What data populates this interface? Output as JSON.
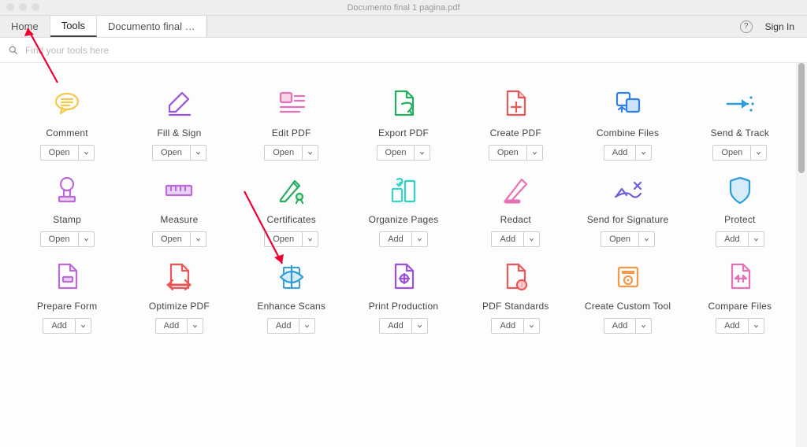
{
  "window": {
    "title": "Documento final 1 pagina.pdf"
  },
  "tabs": {
    "home": "Home",
    "tools": "Tools",
    "doc": "Documento final 1..."
  },
  "header": {
    "help": "?",
    "signin": "Sign In"
  },
  "search": {
    "placeholder": "Find your tools here"
  },
  "buttons": {
    "open": "Open",
    "add": "Add"
  },
  "tools": [
    {
      "label": "Comment",
      "action": "open"
    },
    {
      "label": "Fill & Sign",
      "action": "open"
    },
    {
      "label": "Edit PDF",
      "action": "open"
    },
    {
      "label": "Export PDF",
      "action": "open"
    },
    {
      "label": "Create PDF",
      "action": "open"
    },
    {
      "label": "Combine Files",
      "action": "add"
    },
    {
      "label": "Send & Track",
      "action": "open"
    },
    {
      "label": "Stamp",
      "action": "open"
    },
    {
      "label": "Measure",
      "action": "open"
    },
    {
      "label": "Certificates",
      "action": "open"
    },
    {
      "label": "Organize Pages",
      "action": "add"
    },
    {
      "label": "Redact",
      "action": "add"
    },
    {
      "label": "Send for Signature",
      "action": "open"
    },
    {
      "label": "Protect",
      "action": "add"
    },
    {
      "label": "Prepare Form",
      "action": "add"
    },
    {
      "label": "Optimize PDF",
      "action": "add"
    },
    {
      "label": "Enhance Scans",
      "action": "add"
    },
    {
      "label": "Print Production",
      "action": "add"
    },
    {
      "label": "PDF Standards",
      "action": "add"
    },
    {
      "label": "Create Custom Tool",
      "action": "add"
    },
    {
      "label": "Compare Files",
      "action": "add"
    }
  ],
  "colors": {
    "comment": "#f2c94c",
    "fillsign": "#9b51e0",
    "editpdf": "#e86fb6",
    "export": "#27ae60",
    "create": "#eb5757",
    "combine": "#2f80ed",
    "sendtrack": "#2d9cdb",
    "stamp": "#bb6bd9",
    "measure": "#bb6bd9",
    "certificates": "#27ae60",
    "organize": "#27d7c4",
    "redact": "#e86fb6",
    "signature": "#6b5de0",
    "protect": "#2d9cdb",
    "prepare": "#bb6bd9",
    "optimize": "#eb5757",
    "enhance": "#2d9cdb",
    "print": "#9b51e0",
    "standards": "#eb5757",
    "custom": "#f2994a",
    "compare": "#e86fb6"
  }
}
